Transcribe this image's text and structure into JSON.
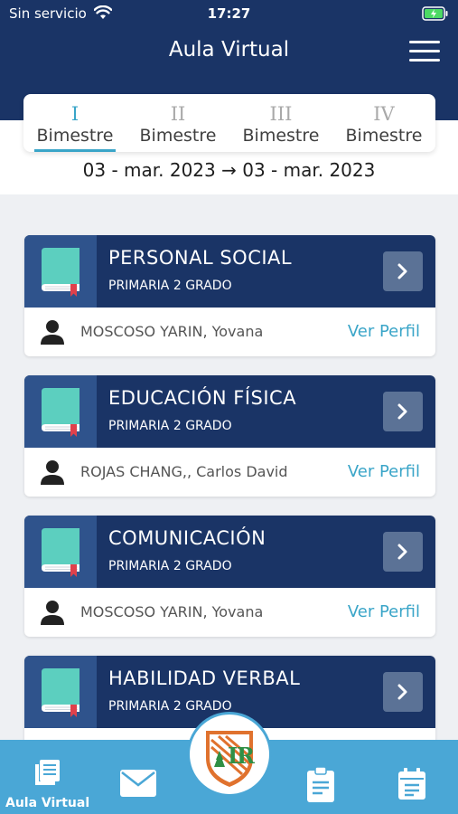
{
  "status": {
    "carrier": "Sin servicio",
    "time": "17:27"
  },
  "header": {
    "title": "Aula Virtual"
  },
  "tabs": [
    {
      "roman": "I",
      "label": "Bimestre",
      "active": true
    },
    {
      "roman": "II",
      "label": "Bimestre",
      "active": false
    },
    {
      "roman": "III",
      "label": "Bimestre",
      "active": false
    },
    {
      "roman": "IV",
      "label": "Bimestre",
      "active": false
    }
  ],
  "date_range": "03 - mar. 2023 → 03 - mar. 2023",
  "courses": [
    {
      "name": "PERSONAL SOCIAL",
      "grade": "PRIMARIA 2 GRADO",
      "teacher": "MOSCOSO YARIN, Yovana",
      "profile_label": "Ver Perfil"
    },
    {
      "name": "EDUCACIÓN FÍSICA",
      "grade": "PRIMARIA 2 GRADO",
      "teacher": "ROJAS CHANG,, Carlos David",
      "profile_label": "Ver Perfil"
    },
    {
      "name": "COMUNICACIÓN",
      "grade": "PRIMARIA 2 GRADO",
      "teacher": "MOSCOSO YARIN, Yovana",
      "profile_label": "Ver Perfil"
    },
    {
      "name": "HABILIDAD VERBAL",
      "grade": "PRIMARIA 2 GRADO",
      "teacher": "",
      "profile_label": ""
    }
  ],
  "bottom_nav": {
    "active_label": "Aula Virtual",
    "icons": [
      "notebook-icon",
      "mail-icon",
      "school-logo",
      "clipboard-icon",
      "calendar-icon"
    ]
  },
  "colors": {
    "primary": "#1a3466",
    "accent": "#3aa5c8",
    "bottom_bar": "#4aa7d6",
    "book": "#5ccfbf"
  }
}
